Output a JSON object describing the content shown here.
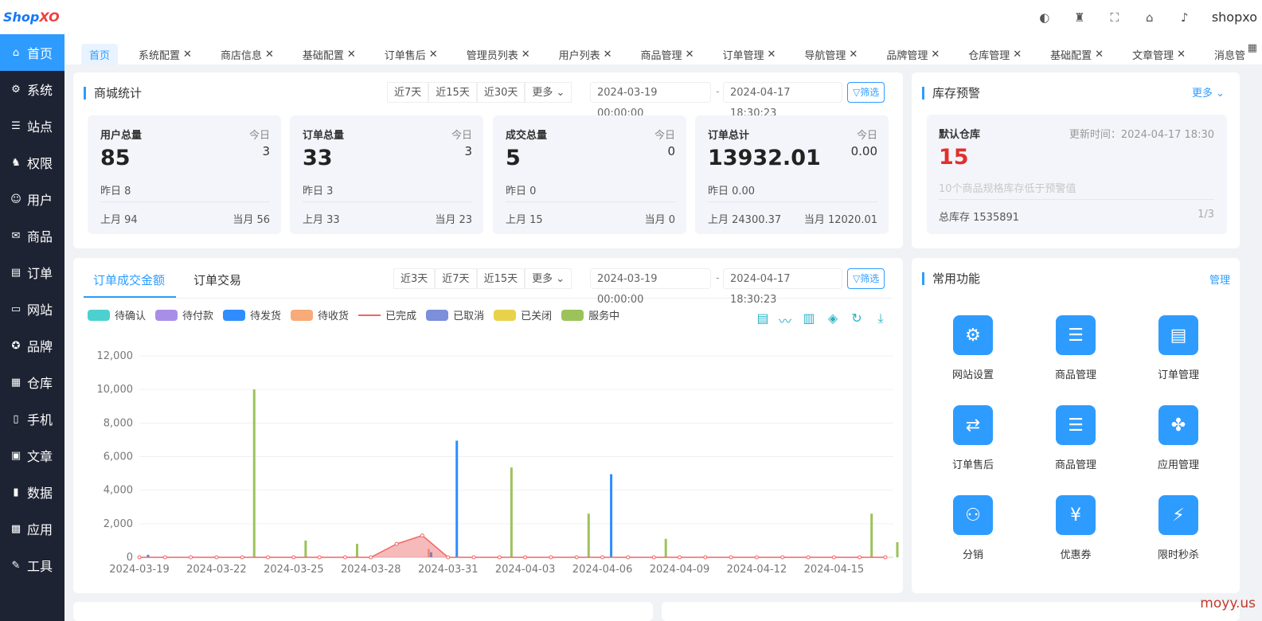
{
  "logo": {
    "part1": "Shop",
    "part2": "XO"
  },
  "sidebar": {
    "items": [
      {
        "label": "首页",
        "icon": "home-icon",
        "glyph": "⌂"
      },
      {
        "label": "系统",
        "icon": "gear-icon",
        "glyph": "⚙"
      },
      {
        "label": "站点",
        "icon": "sliders-icon",
        "glyph": "☰"
      },
      {
        "label": "权限",
        "icon": "user-lock-icon",
        "glyph": "♞"
      },
      {
        "label": "用户",
        "icon": "user-icon",
        "glyph": "☺"
      },
      {
        "label": "商品",
        "icon": "envelope-icon",
        "glyph": "✉"
      },
      {
        "label": "订单",
        "icon": "clipboard-icon",
        "glyph": "▤"
      },
      {
        "label": "网站",
        "icon": "monitor-icon",
        "glyph": "▭"
      },
      {
        "label": "品牌",
        "icon": "award-icon",
        "glyph": "✪"
      },
      {
        "label": "仓库",
        "icon": "boxes-icon",
        "glyph": "▦"
      },
      {
        "label": "手机",
        "icon": "mobile-icon",
        "glyph": "▯"
      },
      {
        "label": "文章",
        "icon": "article-icon",
        "glyph": "▣"
      },
      {
        "label": "数据",
        "icon": "bar-chart-icon",
        "glyph": "▮"
      },
      {
        "label": "应用",
        "icon": "apps-icon",
        "glyph": "▩"
      },
      {
        "label": "工具",
        "icon": "wrench-icon",
        "glyph": "✎"
      }
    ]
  },
  "topbar": {
    "username": "shopxo"
  },
  "tabs": [
    {
      "label": "首页",
      "closable": false
    },
    {
      "label": "系统配置",
      "closable": true
    },
    {
      "label": "商店信息",
      "closable": true
    },
    {
      "label": "基础配置",
      "closable": true
    },
    {
      "label": "订单售后",
      "closable": true
    },
    {
      "label": "管理员列表",
      "closable": true
    },
    {
      "label": "用户列表",
      "closable": true
    },
    {
      "label": "商品管理",
      "closable": true
    },
    {
      "label": "订单管理",
      "closable": true
    },
    {
      "label": "导航管理",
      "closable": true
    },
    {
      "label": "品牌管理",
      "closable": true
    },
    {
      "label": "仓库管理",
      "closable": true
    },
    {
      "label": "基础配置",
      "closable": true
    },
    {
      "label": "文章管理",
      "closable": true
    },
    {
      "label": "消息管",
      "closable": false
    }
  ],
  "mall_stats": {
    "title": "商城统计",
    "ranges": [
      "近7天",
      "近15天",
      "近30天",
      "更多"
    ],
    "start": "2024-03-19 00:00:00",
    "dash": "-",
    "end": "2024-04-17 18:30:23",
    "filter_label": "筛选",
    "cards": [
      {
        "label": "用户总量",
        "today_label": "今日",
        "value": "85",
        "today": "3",
        "yesterday": "昨日  8",
        "last_month": "上月   94",
        "this_month": "当月   56"
      },
      {
        "label": "订单总量",
        "today_label": "今日",
        "value": "33",
        "today": "3",
        "yesterday": "昨日 3",
        "last_month": "上月   33",
        "this_month": "当月   23"
      },
      {
        "label": "成交总量",
        "today_label": "今日",
        "value": "5",
        "today": "0",
        "yesterday": "昨日 0",
        "last_month": "上月   15",
        "this_month": "当月   0"
      },
      {
        "label": "订单总计",
        "today_label": "今日",
        "value": "13932.01",
        "today": "0.00",
        "yesterday": "昨日 0.00",
        "last_month": "上月   24300.37",
        "this_month": "当月   12020.01"
      }
    ]
  },
  "inventory": {
    "title": "库存预警",
    "more": "更多",
    "warehouse": "默认仓库",
    "updated": "更新时间：2024-04-17 18:30",
    "count": "15",
    "note": "10个商品规格库存低于预警值",
    "total": "总库存   1535891",
    "page": "1/3"
  },
  "order_chart": {
    "tab_active": "订单成交金额",
    "tab_other": "订单交易",
    "ranges": [
      "近3天",
      "近7天",
      "近15天",
      "更多"
    ],
    "start": "2024-03-19 00:00:00",
    "dash": "-",
    "end": "2024-04-17 18:30:23",
    "filter_label": "筛选",
    "tool_icons": [
      "data-view-icon",
      "line-icon",
      "bar-icon",
      "stack-icon",
      "refresh-icon",
      "download-icon"
    ]
  },
  "chart_data": {
    "type": "bar",
    "title": "",
    "xlabel": "",
    "ylabel": "",
    "ylim": [
      0,
      12000
    ],
    "yticks": [
      "0",
      "2,000",
      "4,000",
      "6,000",
      "8,000",
      "10,000",
      "12,000"
    ],
    "yticks_values": [
      0,
      2000,
      4000,
      6000,
      8000,
      10000,
      12000
    ],
    "categories": [
      "2024-03-19",
      "2024-03-20",
      "2024-03-21",
      "2024-03-22",
      "2024-03-23",
      "2024-03-24",
      "2024-03-25",
      "2024-03-26",
      "2024-03-27",
      "2024-03-28",
      "2024-03-29",
      "2024-03-30",
      "2024-03-31",
      "2024-04-01",
      "2024-04-02",
      "2024-04-03",
      "2024-04-04",
      "2024-04-05",
      "2024-04-06",
      "2024-04-07",
      "2024-04-08",
      "2024-04-09",
      "2024-04-10",
      "2024-04-11",
      "2024-04-12",
      "2024-04-13",
      "2024-04-14",
      "2024-04-15",
      "2024-04-16",
      "2024-04-17"
    ],
    "xticks": [
      "2024-03-19",
      "2024-03-22",
      "2024-03-25",
      "2024-03-28",
      "2024-03-31",
      "2024-04-03",
      "2024-04-06",
      "2024-04-09",
      "2024-04-12",
      "2024-04-15"
    ],
    "series": [
      {
        "name": "待确认",
        "color": "#4dd0d0",
        "values": [
          0,
          0,
          0,
          0,
          0,
          0,
          0,
          0,
          0,
          0,
          0,
          0,
          0,
          0,
          0,
          0,
          0,
          0,
          0,
          0,
          0,
          0,
          0,
          0,
          0,
          0,
          0,
          0,
          0,
          0
        ]
      },
      {
        "name": "待付款",
        "color": "#a98ee8",
        "values": [
          0,
          0,
          0,
          0,
          0,
          0,
          0,
          0,
          0,
          0,
          0,
          0,
          0,
          0,
          0,
          0,
          0,
          0,
          0,
          0,
          0,
          0,
          0,
          0,
          0,
          0,
          0,
          0,
          0,
          0
        ]
      },
      {
        "name": "待发货",
        "color": "#2e8cff",
        "values": [
          150,
          0,
          0,
          0,
          0,
          0,
          0,
          0,
          0,
          0,
          0,
          300,
          6950,
          0,
          0,
          0,
          0,
          0,
          4950,
          0,
          0,
          0,
          0,
          0,
          0,
          0,
          0,
          0,
          0,
          0
        ]
      },
      {
        "name": "待收货",
        "color": "#f8aa78",
        "values": [
          0,
          0,
          0,
          0,
          0,
          0,
          0,
          0,
          0,
          0,
          0,
          500,
          0,
          0,
          0,
          0,
          0,
          0,
          0,
          0,
          0,
          0,
          0,
          0,
          0,
          0,
          0,
          0,
          0,
          0
        ]
      },
      {
        "name": "已完成",
        "color": "#ee6666",
        "values": [
          0,
          0,
          0,
          0,
          0,
          0,
          0,
          0,
          0,
          0,
          800,
          1300,
          0,
          0,
          0,
          0,
          0,
          0,
          0,
          0,
          0,
          0,
          0,
          0,
          0,
          0,
          0,
          0,
          0,
          0
        ]
      },
      {
        "name": "已取消",
        "color": "#7b8fdb",
        "values": [
          0,
          0,
          0,
          0,
          0,
          0,
          0,
          0,
          0,
          0,
          0,
          0,
          0,
          0,
          0,
          0,
          0,
          0,
          0,
          0,
          0,
          0,
          0,
          0,
          0,
          0,
          0,
          0,
          0,
          0
        ]
      },
      {
        "name": "已关闭",
        "color": "#e8d24a",
        "values": [
          0,
          0,
          0,
          0,
          0,
          0,
          0,
          0,
          0,
          0,
          0,
          0,
          0,
          0,
          0,
          0,
          0,
          0,
          0,
          0,
          0,
          0,
          0,
          0,
          0,
          0,
          0,
          0,
          0,
          0
        ]
      },
      {
        "name": "服务中",
        "color": "#9bc35a",
        "values": [
          0,
          0,
          0,
          0,
          10000,
          0,
          1000,
          0,
          800,
          0,
          0,
          0,
          0,
          0,
          5350,
          0,
          0,
          2600,
          0,
          0,
          1100,
          0,
          0,
          0,
          0,
          0,
          0,
          0,
          2600,
          900
        ]
      }
    ]
  },
  "common_functions": {
    "title": "常用功能",
    "manage": "管理",
    "items": [
      {
        "label": "网站设置",
        "icon": "site-settings-icon",
        "glyph": "⚙"
      },
      {
        "label": "商品管理",
        "icon": "goods-icon",
        "glyph": "☰"
      },
      {
        "label": "订单管理",
        "icon": "order-doc-icon",
        "glyph": "▤"
      },
      {
        "label": "订单售后",
        "icon": "exchange-icon",
        "glyph": "⇄"
      },
      {
        "label": "商品管理",
        "icon": "goods-icon",
        "glyph": "☰"
      },
      {
        "label": "应用管理",
        "icon": "apps-icon",
        "glyph": "✤"
      },
      {
        "label": "分销",
        "icon": "distribution-icon",
        "glyph": "⚇"
      },
      {
        "label": "优惠券",
        "icon": "coupon-icon",
        "glyph": "¥"
      },
      {
        "label": "限时秒杀",
        "icon": "flash-icon",
        "glyph": "⚡"
      }
    ]
  },
  "watermark": "moyy.us"
}
